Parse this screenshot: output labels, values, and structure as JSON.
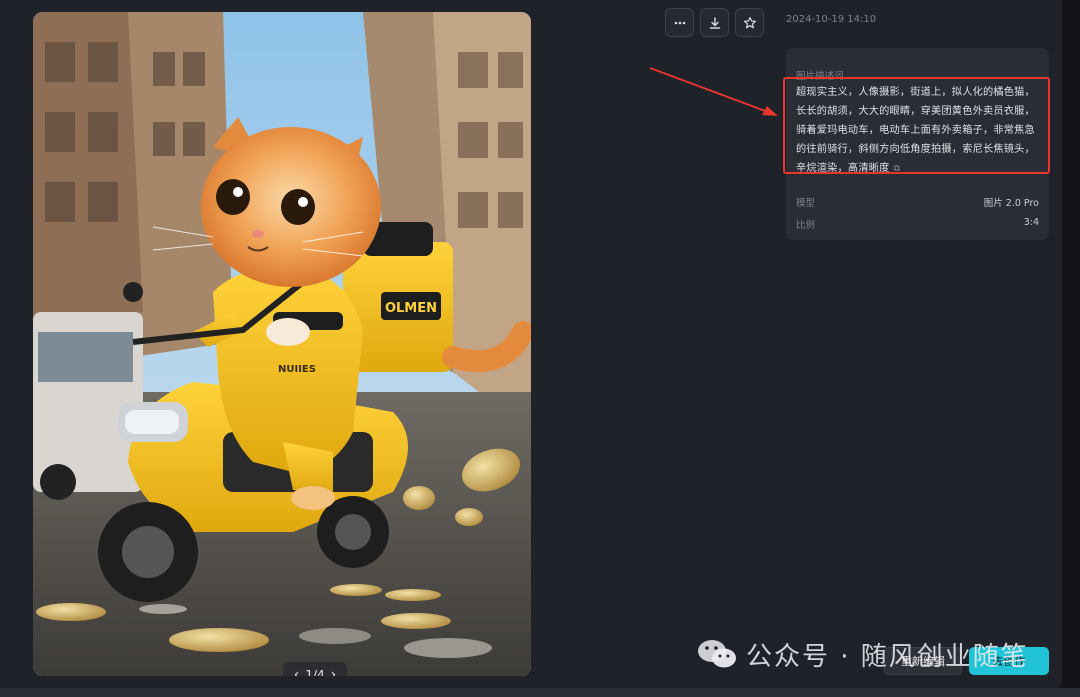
{
  "viewer": {
    "pager_text": "1/4",
    "prev_glyph": "‹",
    "next_glyph": "›",
    "image_subject": "orange cat courier riding yellow electric scooter on city street with coins",
    "backpack_text": "OLMEN",
    "badge_text": "NUIIES"
  },
  "toolbar": {
    "more_icon": "more-horizontal-icon",
    "download_icon": "download-icon",
    "favorite_icon": "star-icon",
    "timestamp": "2024-10-19 14:10"
  },
  "info": {
    "desc_title": "图片描述词",
    "description": "超现实主义，人像摄影，街道上，拟人化的橘色猫，长长的胡须，大大的眼睛，穿美团黄色外卖员衣服，骑着爱玛电动车，电动车上面有外卖箱子，非常焦急的往前骑行，斜侧方向低角度拍摄，索尼长焦镜头，辛烷渲染，高清晰度",
    "model_label": "模型",
    "model_value": "图片 2.0 Pro",
    "ratio_label": "比例",
    "ratio_value": "3:4"
  },
  "actions": {
    "reedit_label": "重新编辑",
    "primary_label": "去创作"
  },
  "watermark": {
    "text": "公众号 · 随风创业随笔"
  },
  "colors": {
    "accent": "#21c4d6",
    "annotation_red": "#e8352e",
    "panel_bg": "#1f2229",
    "card_bg": "#2a2d35"
  }
}
